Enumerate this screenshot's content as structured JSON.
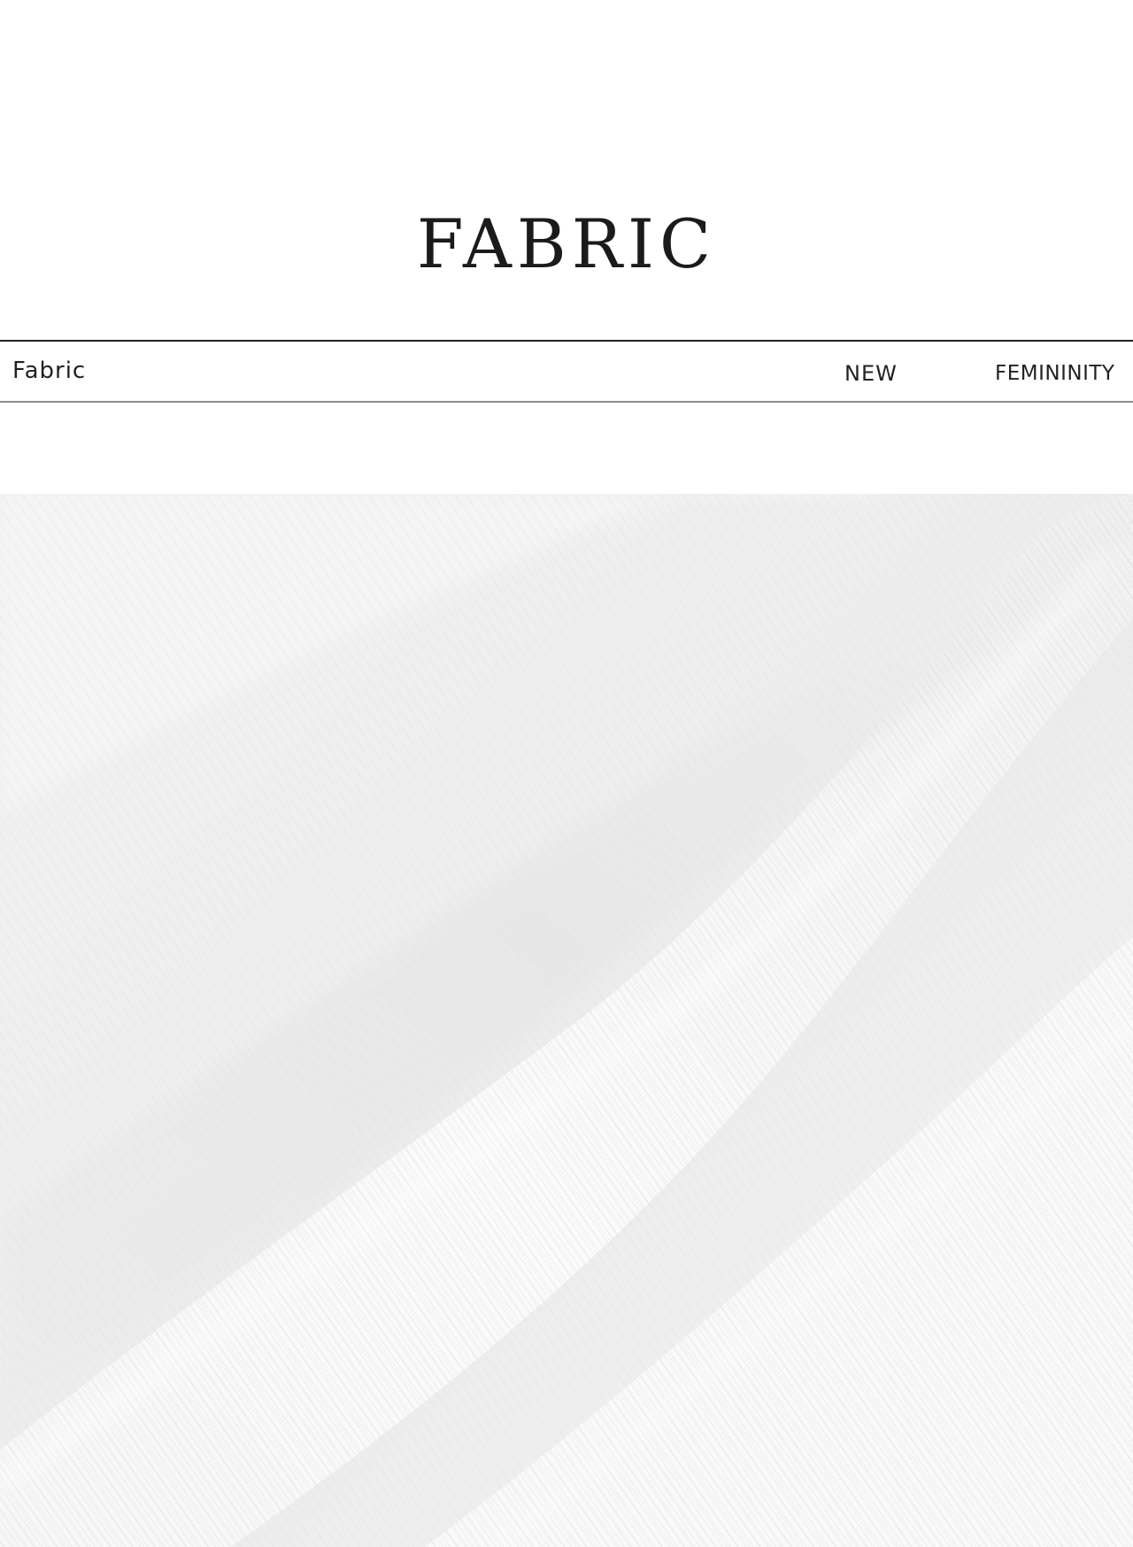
{
  "headline": "FABRIC",
  "label_bar": {
    "left_label": "Fabric",
    "right_labels": [
      "NEW",
      "FEMININITY"
    ]
  },
  "photo": {
    "subject": "fabric-close-up",
    "colors": {
      "base": "#f1f1f1",
      "shadow": "#e2e2e2",
      "highlight": "#fbfbfb"
    }
  }
}
